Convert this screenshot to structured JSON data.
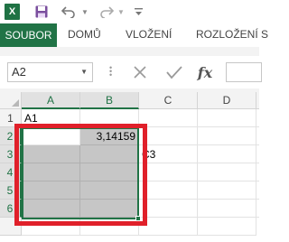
{
  "quick_access": {
    "app_icon": "excel-icon",
    "app_icon_glyph": "X",
    "save_icon": "save-icon",
    "undo_icon": "undo-icon",
    "redo_icon": "redo-icon",
    "customize_icon": "customize-toolbar-icon"
  },
  "ribbon": {
    "tabs": [
      "SOUBOR",
      "DOMŮ",
      "VLOŽENÍ",
      "ROZLOŽENÍ S"
    ],
    "accent_color": "#217346"
  },
  "formula_bar": {
    "name_box": "A2",
    "cancel_icon": "cancel-icon",
    "enter_icon": "enter-icon",
    "function_icon": "fx-icon",
    "function_label": "fx",
    "formula": ""
  },
  "sheet": {
    "columns": [
      "A",
      "B",
      "C",
      "D"
    ],
    "rows": [
      "1",
      "2",
      "3",
      "4",
      "5",
      "6"
    ],
    "cells": {
      "A1": "A1",
      "B2": "3,14159",
      "C3": "C3"
    },
    "active_cell": "A2",
    "selected_range": "A2:B6",
    "highlight_color": "#e0202a"
  }
}
